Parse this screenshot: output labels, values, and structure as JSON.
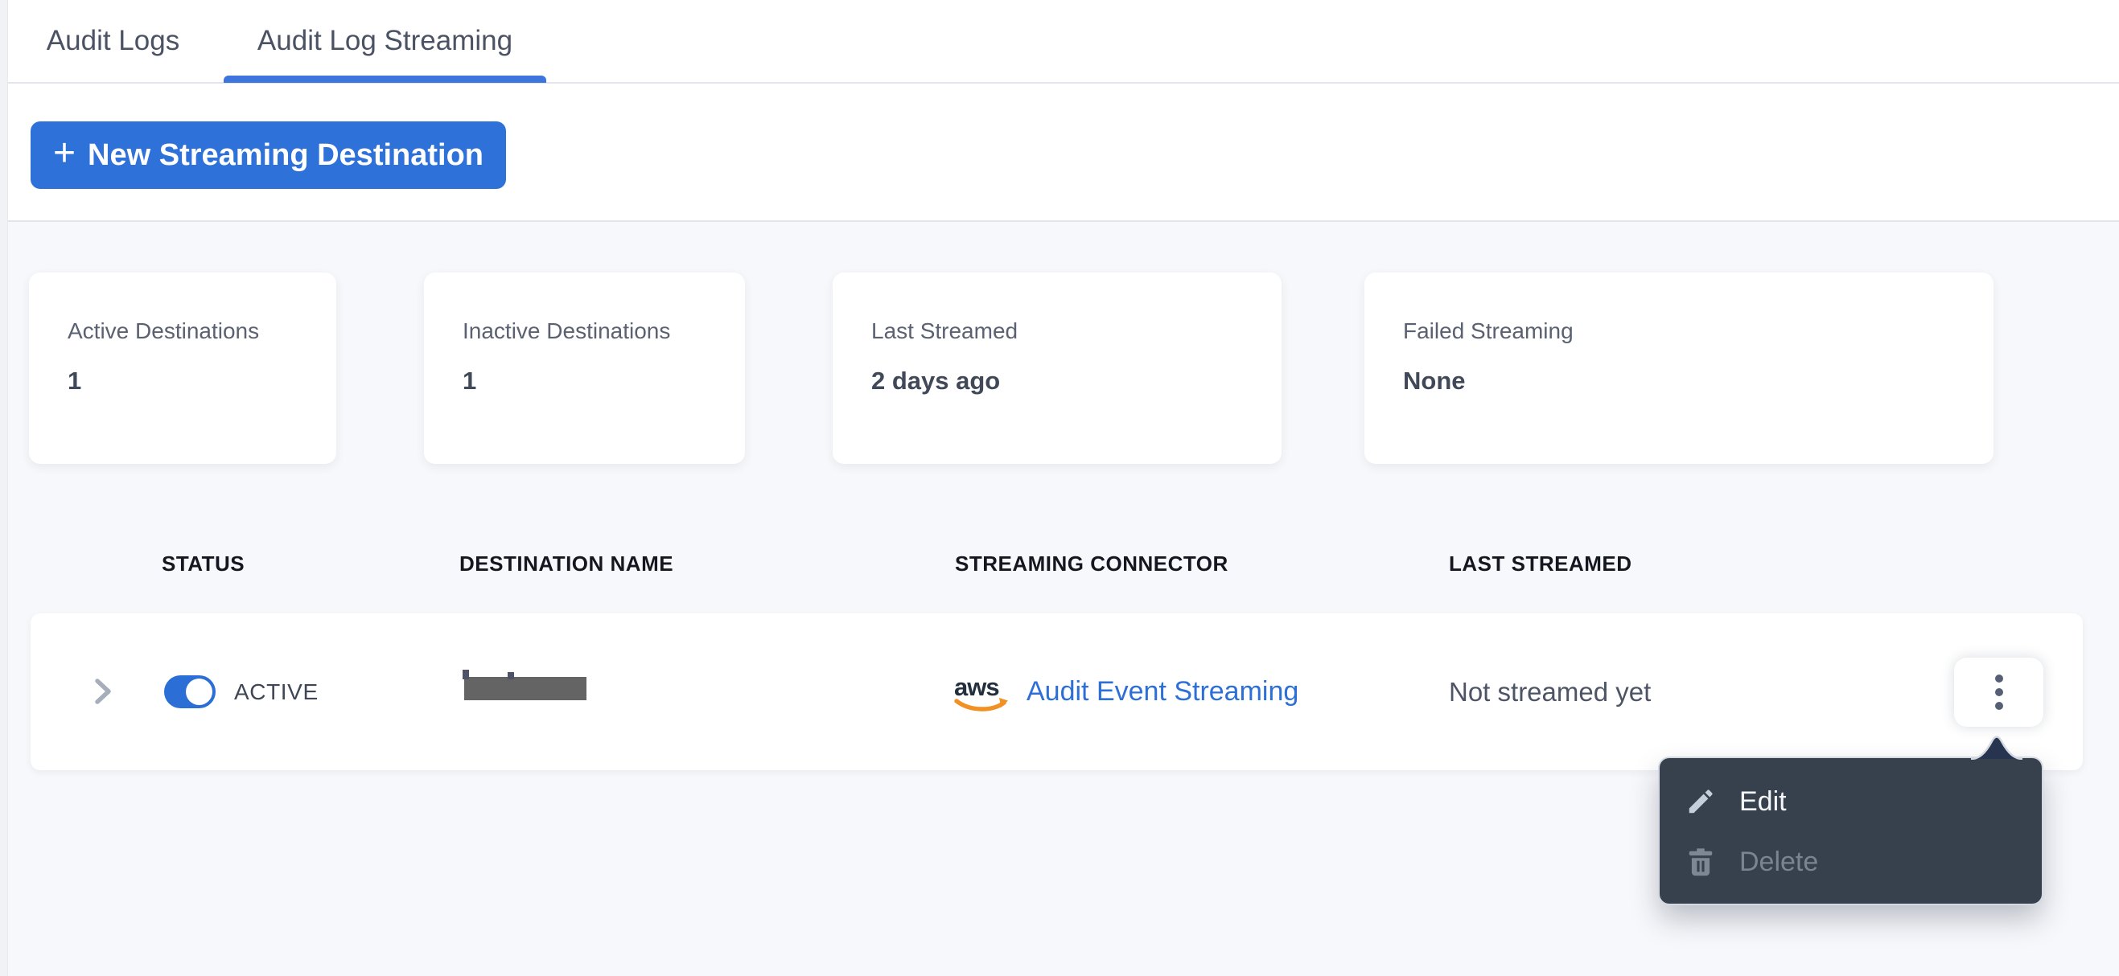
{
  "tabs": [
    {
      "label": "Audit Logs",
      "active": false
    },
    {
      "label": "Audit Log Streaming",
      "active": true
    }
  ],
  "toolbar": {
    "plus_glyph": "+",
    "new_destination_label": "New Streaming Destination"
  },
  "stats": [
    {
      "label": "Active Destinations",
      "value": "1"
    },
    {
      "label": "Inactive Destinations",
      "value": "1"
    },
    {
      "label": "Last Streamed",
      "value": "2 days ago"
    },
    {
      "label": "Failed Streaming",
      "value": "None"
    }
  ],
  "table": {
    "headers": [
      "STATUS",
      "DESTINATION NAME",
      "STREAMING CONNECTOR",
      "LAST STREAMED"
    ],
    "row": {
      "status_label": "ACTIVE",
      "toggle_state": "on",
      "destination_name_redacted": true,
      "connector_brand": "aws",
      "connector_link": "Audit Event Streaming",
      "last_streamed": "Not streamed yet"
    }
  },
  "menu": {
    "items": [
      {
        "label": "Edit",
        "icon": "pencil-icon",
        "disabled": false
      },
      {
        "label": "Delete",
        "icon": "trash-icon",
        "disabled": true
      }
    ]
  },
  "colors": {
    "accent_blue": "#2e71d9",
    "tab_underline_blue": "#3e74dd",
    "link_blue": "#2d6fd6",
    "toggle_blue": "#2b6fd6",
    "menu_bg": "#37414d",
    "menu_beak": "#263450",
    "redaction_gray": "#646464",
    "aws_orange": "#f29123",
    "page_bg": "#f7f8fb"
  }
}
